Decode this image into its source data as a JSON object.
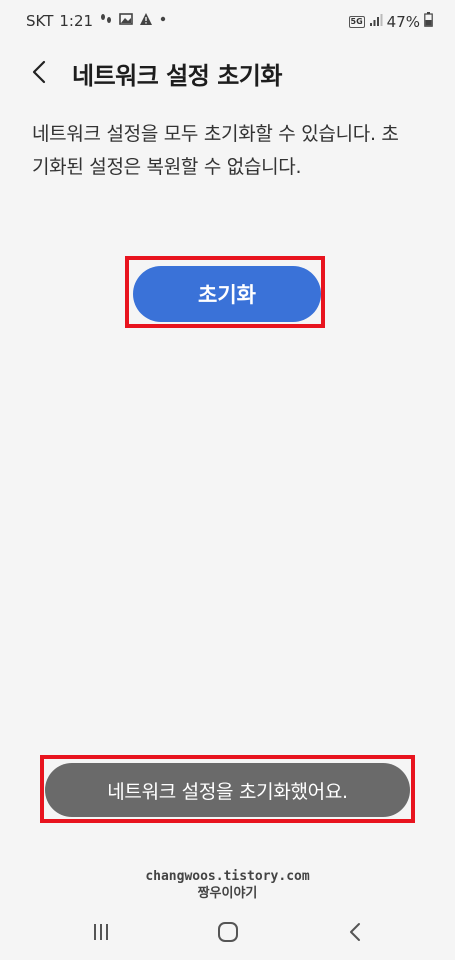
{
  "status_bar": {
    "carrier": "SKT",
    "time": "1:21",
    "network": "5G",
    "battery": "47%"
  },
  "header": {
    "title": "네트워크 설정 초기화"
  },
  "description": "네트워크 설정을 모두 초기화할 수 있습니다. 초기화된 설정은 복원할 수 없습니다.",
  "reset_button": {
    "label": "초기화"
  },
  "toast": {
    "message": "네트워크 설정을 초기화했어요."
  },
  "watermark": {
    "line1": "changwoos.tistory.com",
    "line2": "짱우이야기"
  },
  "colors": {
    "accent": "#3a72d8",
    "highlight": "#e8141e",
    "toast_bg": "#6a6a6a",
    "background": "#f5f5f5"
  }
}
